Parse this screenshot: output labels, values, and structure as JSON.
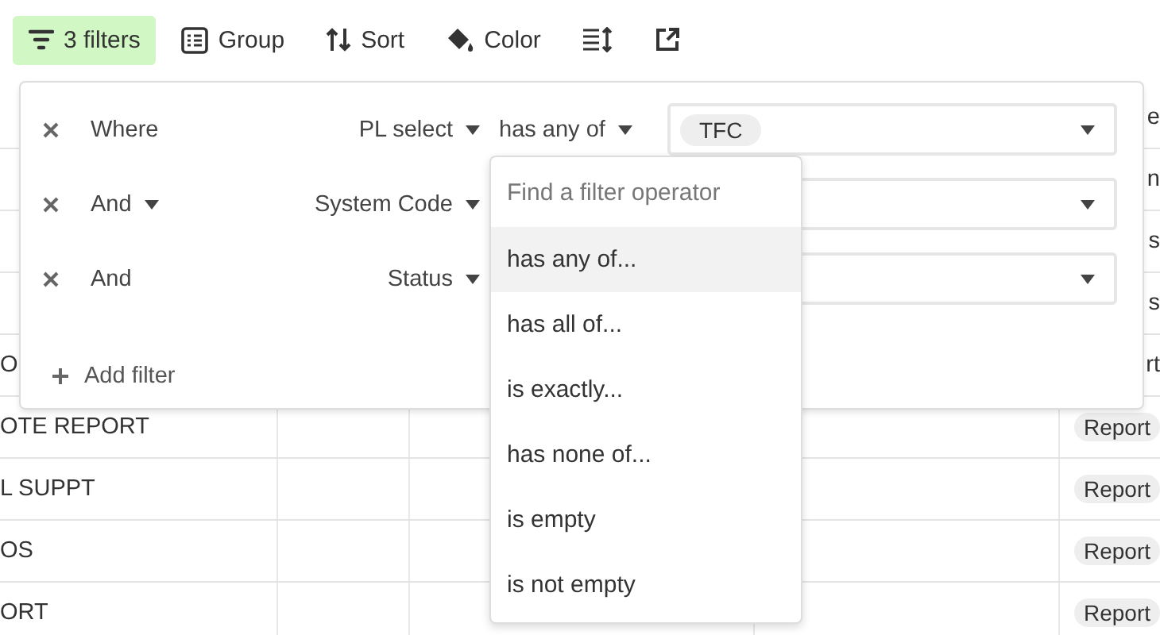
{
  "toolbar": {
    "items": [
      {
        "kind": "filter",
        "label": "3 filters",
        "active": true
      },
      {
        "kind": "group",
        "label": "Group",
        "active": false
      },
      {
        "kind": "sort",
        "label": "Sort",
        "active": false
      },
      {
        "kind": "color",
        "label": "Color",
        "active": false
      },
      {
        "kind": "row-height",
        "active": false
      },
      {
        "kind": "share",
        "active": false
      }
    ]
  },
  "table": {
    "rows": [
      {
        "kind": "partial",
        "name": "",
        "status": "e"
      },
      {
        "kind": "partial",
        "name": "",
        "status": "n"
      },
      {
        "kind": "partial",
        "name": "",
        "status": "s"
      },
      {
        "kind": "partial",
        "name": "",
        "status": "s"
      },
      {
        "kind": "partial",
        "name": "O",
        "status": "rt"
      },
      {
        "kind": "full",
        "name": "OTE REPORT",
        "status": "Report"
      },
      {
        "kind": "full",
        "name": "L SUPPT",
        "status": "Report"
      },
      {
        "kind": "full",
        "name": "OS",
        "status": "Report"
      },
      {
        "kind": "full",
        "name": "ORT",
        "status": "Report"
      }
    ]
  },
  "filter_panel": {
    "filters": [
      {
        "conjunction": "Where",
        "conjunction_dropdown": false,
        "field": "PL select",
        "operator": "has any of",
        "values": [
          "TFC"
        ]
      },
      {
        "conjunction": "And",
        "conjunction_dropdown": true,
        "field": "System Code"
      },
      {
        "conjunction": "And",
        "conjunction_dropdown": false,
        "field": "Status"
      }
    ],
    "add_filter": "Add filter"
  },
  "operator_menu": {
    "placeholder": "Find a filter operator",
    "options": [
      {
        "label": "has any of...",
        "selected": true
      },
      {
        "label": "has all of...",
        "selected": false
      },
      {
        "label": "is exactly...",
        "selected": false
      },
      {
        "label": "has none of...",
        "selected": false
      },
      {
        "label": "is empty",
        "selected": false
      },
      {
        "label": "is not empty",
        "selected": false
      }
    ]
  }
}
